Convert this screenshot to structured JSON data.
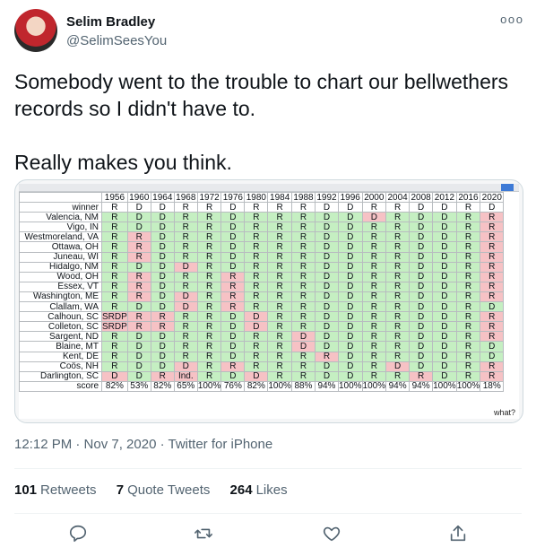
{
  "author": {
    "name": "Selim Bradley",
    "handle": "@SelimSeesYou"
  },
  "tweet": {
    "text": "Somebody went to the trouble to chart our bellwethers records so I didn't have to.\n\nReally makes you think."
  },
  "table": {
    "years": [
      "1956",
      "1960",
      "1964",
      "1968",
      "1972",
      "1976",
      "1980",
      "1984",
      "1988",
      "1992",
      "1996",
      "2000",
      "2004",
      "2008",
      "2012",
      "2016",
      "2020"
    ],
    "winner_label": "winner",
    "winners": [
      "R",
      "D",
      "D",
      "R",
      "R",
      "D",
      "R",
      "R",
      "R",
      "D",
      "D",
      "R",
      "R",
      "D",
      "D",
      "R",
      "D"
    ],
    "rows": [
      {
        "place": "Valencia, NM",
        "values": [
          "R",
          "D",
          "D",
          "R",
          "R",
          "D",
          "R",
          "R",
          "R",
          "D",
          "D",
          "D",
          "R",
          "D",
          "D",
          "R",
          "R"
        ]
      },
      {
        "place": "Vigo, IN",
        "values": [
          "R",
          "D",
          "D",
          "R",
          "R",
          "D",
          "R",
          "R",
          "R",
          "D",
          "D",
          "R",
          "R",
          "D",
          "D",
          "R",
          "R"
        ]
      },
      {
        "place": "Westmoreland, VA",
        "values": [
          "R",
          "R",
          "D",
          "R",
          "R",
          "D",
          "R",
          "R",
          "R",
          "D",
          "D",
          "R",
          "R",
          "D",
          "D",
          "R",
          "R"
        ]
      },
      {
        "place": "Ottawa, OH",
        "values": [
          "R",
          "R",
          "D",
          "R",
          "R",
          "D",
          "R",
          "R",
          "R",
          "D",
          "D",
          "R",
          "R",
          "D",
          "D",
          "R",
          "R"
        ]
      },
      {
        "place": "Juneau, WI",
        "values": [
          "R",
          "R",
          "D",
          "R",
          "R",
          "D",
          "R",
          "R",
          "R",
          "D",
          "D",
          "R",
          "R",
          "D",
          "D",
          "R",
          "R"
        ]
      },
      {
        "place": "Hidalgo, NM",
        "values": [
          "R",
          "D",
          "D",
          "D",
          "R",
          "D",
          "R",
          "R",
          "R",
          "D",
          "D",
          "R",
          "R",
          "D",
          "D",
          "R",
          "R"
        ]
      },
      {
        "place": "Wood, OH",
        "values": [
          "R",
          "R",
          "D",
          "R",
          "R",
          "R",
          "R",
          "R",
          "R",
          "D",
          "D",
          "R",
          "R",
          "D",
          "D",
          "R",
          "R"
        ]
      },
      {
        "place": "Essex, VT",
        "values": [
          "R",
          "R",
          "D",
          "R",
          "R",
          "R",
          "R",
          "R",
          "R",
          "D",
          "D",
          "R",
          "R",
          "D",
          "D",
          "R",
          "R"
        ]
      },
      {
        "place": "Washington, ME",
        "values": [
          "R",
          "R",
          "D",
          "D",
          "R",
          "R",
          "R",
          "R",
          "R",
          "D",
          "D",
          "R",
          "R",
          "D",
          "D",
          "R",
          "R"
        ]
      },
      {
        "place": "Clallam, WA",
        "values": [
          "R",
          "D",
          "D",
          "D",
          "R",
          "R",
          "R",
          "R",
          "R",
          "D",
          "D",
          "R",
          "R",
          "D",
          "D",
          "R",
          "D"
        ]
      },
      {
        "place": "Calhoun, SC",
        "values": [
          "SRDP",
          "R",
          "R",
          "R",
          "R",
          "D",
          "D",
          "R",
          "R",
          "D",
          "D",
          "R",
          "R",
          "D",
          "D",
          "R",
          "R"
        ]
      },
      {
        "place": "Colleton, SC",
        "values": [
          "SRDP",
          "R",
          "R",
          "R",
          "R",
          "D",
          "D",
          "R",
          "R",
          "D",
          "D",
          "R",
          "R",
          "D",
          "D",
          "R",
          "R"
        ]
      },
      {
        "place": "Sargent, ND",
        "values": [
          "R",
          "D",
          "D",
          "R",
          "R",
          "D",
          "R",
          "R",
          "D",
          "D",
          "D",
          "R",
          "R",
          "D",
          "D",
          "R",
          "R"
        ]
      },
      {
        "place": "Blaine, MT",
        "values": [
          "R",
          "D",
          "D",
          "R",
          "R",
          "D",
          "R",
          "R",
          "D",
          "D",
          "D",
          "R",
          "R",
          "D",
          "D",
          "R",
          "D"
        ]
      },
      {
        "place": "Kent, DE",
        "values": [
          "R",
          "D",
          "D",
          "R",
          "R",
          "D",
          "R",
          "R",
          "R",
          "R",
          "D",
          "R",
          "R",
          "D",
          "D",
          "R",
          "D"
        ]
      },
      {
        "place": "Coös, NH",
        "values": [
          "R",
          "D",
          "D",
          "D",
          "R",
          "R",
          "R",
          "R",
          "R",
          "D",
          "D",
          "R",
          "D",
          "D",
          "D",
          "R",
          "R"
        ]
      },
      {
        "place": "Darlington, SC",
        "values": [
          "D",
          "D",
          "R",
          "Ind.",
          "R",
          "D",
          "D",
          "R",
          "R",
          "D",
          "D",
          "R",
          "R",
          "R",
          "D",
          "R",
          "R"
        ]
      }
    ],
    "score_label": "score",
    "scores": [
      "82%",
      "53%",
      "82%",
      "65%",
      "100%",
      "76%",
      "82%",
      "100%",
      "88%",
      "94%",
      "100%",
      "100%",
      "94%",
      "94%",
      "100%",
      "100%",
      "18%"
    ],
    "what_note": "what?"
  },
  "timestamp": "12:12 PM · Nov 7, 2020 · Twitter for iPhone",
  "stats": {
    "retweets_count": "101",
    "retweets_label": "Retweets",
    "quotes_count": "7",
    "quotes_label": "Quote Tweets",
    "likes_count": "264",
    "likes_label": "Likes"
  },
  "colors": {
    "match": "#c5efc2",
    "miss": "#f6c2c5",
    "text_secondary": "#536471"
  },
  "icons": [
    "reply-icon",
    "retweet-icon",
    "like-icon",
    "share-icon",
    "more-icon"
  ]
}
